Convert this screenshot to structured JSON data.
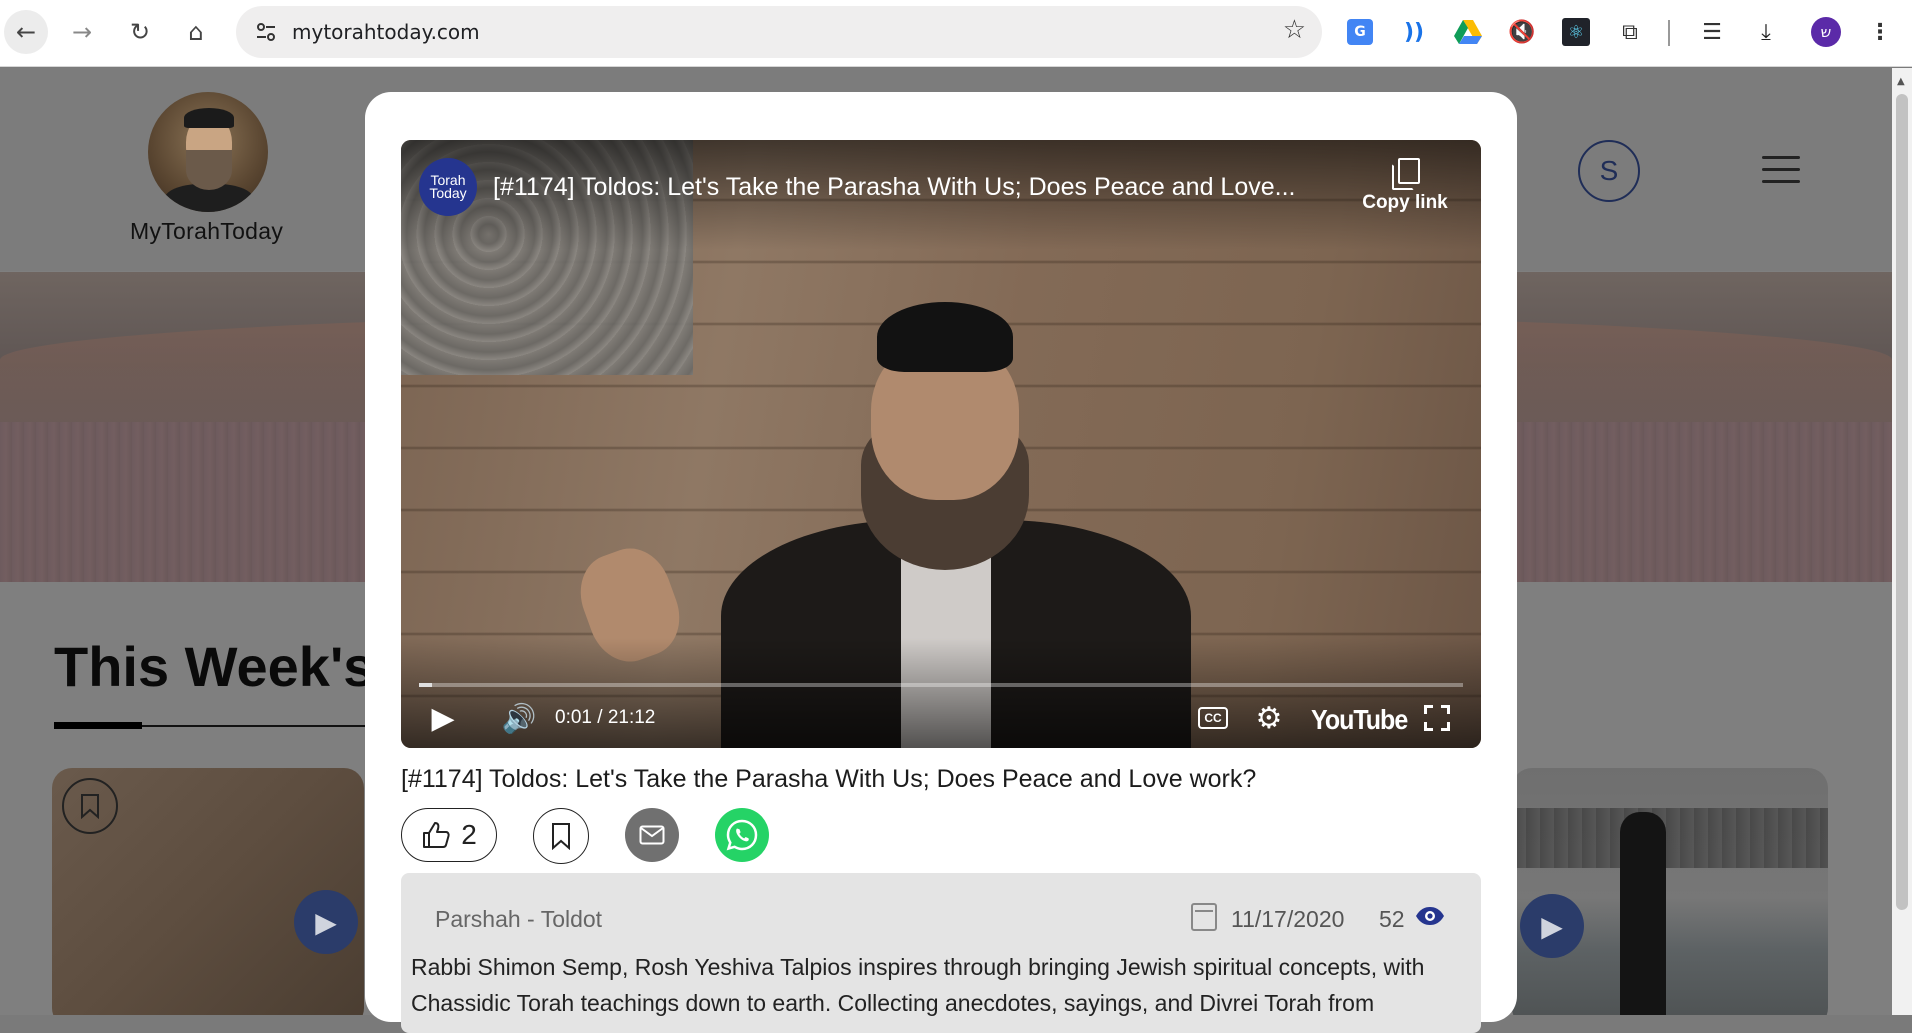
{
  "browser": {
    "url": "mytorahtoday.com",
    "profile_initial": "ש",
    "icons": [
      "back-arrow-icon",
      "forward-arrow-icon",
      "reload-icon",
      "home-icon",
      "site-settings-icon",
      "bookmark-star-icon",
      "google-translate-icon",
      "read-aloud-icon",
      "google-drive-icon",
      "mute-tab-icon",
      "react-devtools-icon",
      "extensions-puzzle-icon",
      "media-queue-icon",
      "download-icon",
      "kebab-menu-icon"
    ]
  },
  "site": {
    "name": "MyTorahToday",
    "user_initial": "S",
    "section_title": "This Week's"
  },
  "video": {
    "channel_logo_line1": "Torah",
    "channel_logo_line2": "Today",
    "title": "[#1174] Toldos: Let's Take the Parasha With Us; Does Peace and Love...",
    "copy_link_label": "Copy link",
    "time": "0:01 / 21:12",
    "cc_label": "CC",
    "brand": "YouTube",
    "progress_percent": 1.2
  },
  "modal": {
    "title": "[#1174] Toldos: Let's Take the Parasha With Us; Does Peace and Love work?",
    "like_count": "2",
    "category": "Parshah - Toldot",
    "date": "11/17/2020",
    "views": "52",
    "description": "Rabbi Shimon Semp, Rosh Yeshiva Talpios inspires through bringing Jewish spiritual concepts, with Chassidic Torah teachings down to earth. Collecting anecdotes, sayings, and Divrei Torah from"
  },
  "colors": {
    "accent_navy": "#25358f",
    "whatsapp_green": "#25d366",
    "overlay_gray": "#7f7f7f"
  }
}
